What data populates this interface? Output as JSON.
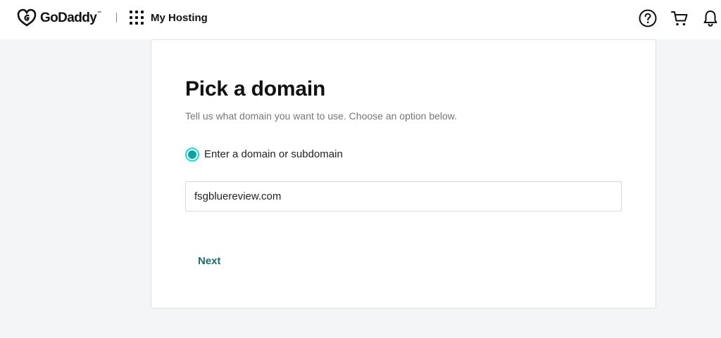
{
  "header": {
    "brand": "GoDaddy",
    "brand_mark": "™",
    "section_title": "My Hosting",
    "icons": [
      "godaddy-logo-icon",
      "apps-grid-icon",
      "help-icon",
      "cart-icon",
      "bell-icon"
    ]
  },
  "form": {
    "title": "Pick a domain",
    "subtitle": "Tell us what domain you want to use. Choose an option below.",
    "option_label": "Enter a domain or subdomain",
    "option_selected": true,
    "domain_value": "fsgbluereview.com",
    "next_label": "Next"
  },
  "colors": {
    "accent": "#00a4a6",
    "button_text": "#1a6e6f",
    "page_background": "#f4f5f7"
  }
}
